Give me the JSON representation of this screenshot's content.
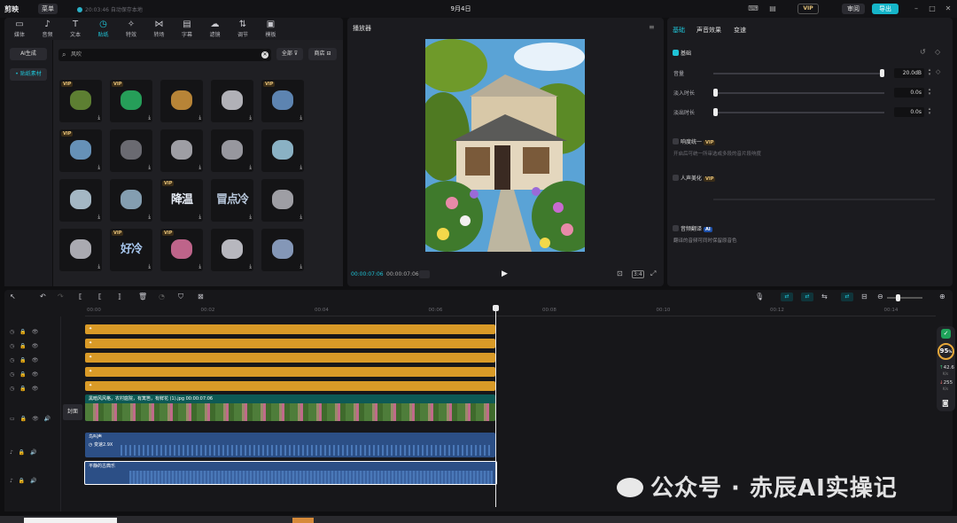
{
  "app": {
    "logo": "剪映",
    "menu_label": "菜单",
    "save_status": "20:03:46 自动保存本地",
    "title": "9月4日",
    "vip": "VIP",
    "review_label": "审阅",
    "export_label": "导出"
  },
  "tabs": [
    {
      "label": "媒体",
      "icon": "▭"
    },
    {
      "label": "音频",
      "icon": "♪"
    },
    {
      "label": "文本",
      "icon": "T"
    },
    {
      "label": "贴纸",
      "icon": "◷"
    },
    {
      "label": "特效",
      "icon": "✧"
    },
    {
      "label": "转场",
      "icon": "⋈"
    },
    {
      "label": "字幕",
      "icon": "▤"
    },
    {
      "label": "滤镜",
      "icon": "☁"
    },
    {
      "label": "调节",
      "icon": "⇅"
    },
    {
      "label": "模板",
      "icon": "▣"
    }
  ],
  "sidebar": {
    "ai": "AI生成",
    "stickers": "• 贴纸素材"
  },
  "search": {
    "value": "风吹",
    "filter_all": "全部",
    "store": "商店"
  },
  "thumbs": [
    {
      "text": "",
      "vip": "VIP",
      "color": "#6f9a3a"
    },
    {
      "text": "",
      "vip": "VIP",
      "color": "#2bc06a"
    },
    {
      "text": "",
      "vip": "",
      "color": "#e0a040"
    },
    {
      "text": "",
      "vip": "",
      "color": "#d8d8e0"
    },
    {
      "text": "",
      "vip": "VIP",
      "color": "#6fa0d8"
    },
    {
      "text": "",
      "vip": "VIP",
      "color": "#7ab0e0"
    },
    {
      "text": "",
      "vip": "",
      "color": "#808088"
    },
    {
      "text": "",
      "vip": "",
      "color": "#c0c0c8"
    },
    {
      "text": "",
      "vip": "",
      "color": "#b8b8c0"
    },
    {
      "text": "",
      "vip": "",
      "color": "#a8d8f0"
    },
    {
      "text": "",
      "vip": "",
      "color": "#c8e0f0"
    },
    {
      "text": "",
      "vip": "",
      "color": "#a0c0d8"
    },
    {
      "text": "降温",
      "vip": "VIP",
      "color": "#e8eef8"
    },
    {
      "text": "冒点冷",
      "vip": "",
      "color": "#b8c8dc"
    },
    {
      "text": "",
      "vip": "",
      "color": "#c0c0c8"
    },
    {
      "text": "",
      "vip": "",
      "color": "#d0d0d8"
    },
    {
      "text": "好冷",
      "vip": "VIP",
      "color": "#a8c8f0"
    },
    {
      "text": "",
      "vip": "VIP",
      "color": "#e878a8"
    },
    {
      "text": "",
      "vip": "",
      "color": "#e0e0e8"
    },
    {
      "text": "",
      "vip": "",
      "color": "#a0b8e0"
    }
  ],
  "player": {
    "title": "播放器",
    "current": "00:00:07:06",
    "total": "00:00:07:06",
    "ratio": "3:4"
  },
  "props": {
    "tabs": [
      "基础",
      "声音效果",
      "变速"
    ],
    "basic": "基础",
    "volume_label": "音量",
    "volume_value": "20.0dB",
    "volume_level": 1.0,
    "fadein_label": "淡入时长",
    "fadein_value": "0.0s",
    "fadein_level": 0.0,
    "fadeout_label": "淡出时长",
    "fadeout_value": "0.0s",
    "fadeout_level": 0.0,
    "loudness_label": "响度统一",
    "loudness_desc": "开启后可统一所审选或多段的音片段响度",
    "voice_label": "人声美化",
    "translate_label": "音频翻译",
    "translate_desc": "翻译的音频可同时保留原音色",
    "vip": "VIP",
    "ai": "AI"
  },
  "timeline": {
    "ticks": [
      "00:00",
      "00:02",
      "00:04",
      "00:06",
      "00:08",
      "00:10",
      "00:12",
      "00:14"
    ],
    "cover_label": "封面",
    "video_clip": "黑暗风风格，农村庭院，有篱笆，有鲜花 (1).jpg  00:00:07:06",
    "audio1": "鸟叫声",
    "audio1_speed": "变速2.9X",
    "audio2": "平静的古典乐"
  },
  "widget": {
    "score": "95",
    "score_unit": "%",
    "up": "42.6",
    "up_unit": "K/s",
    "down": "255",
    "down_unit": "K/s"
  },
  "watermark": "公众号 · 赤辰AI实操记"
}
